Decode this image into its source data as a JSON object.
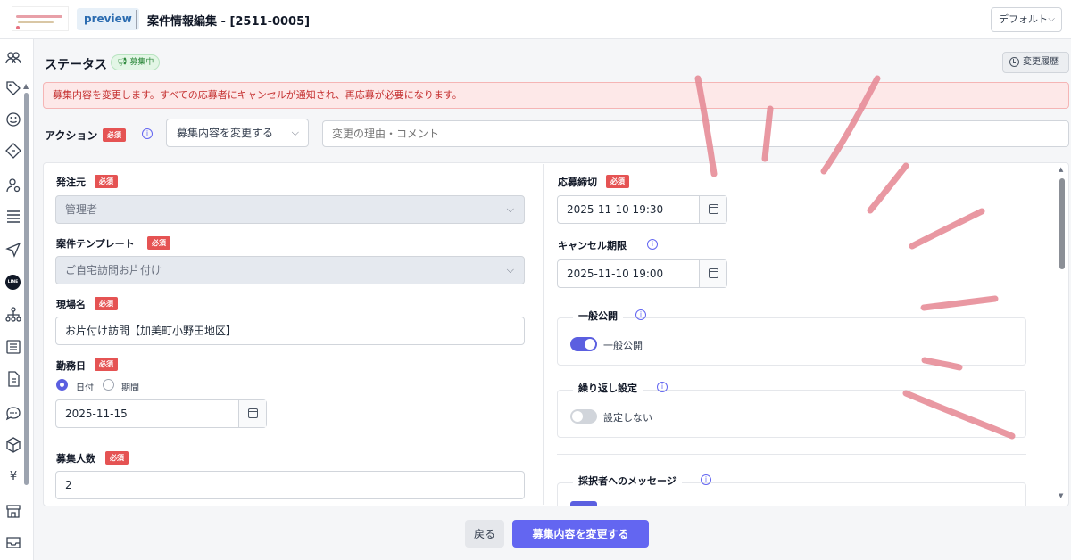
{
  "header": {
    "preview_label": "preview",
    "title": "案件情報編集 - [2511-0005]",
    "view_select": "デフォルト"
  },
  "sidebar": {
    "icons": [
      "people-icon",
      "tag-icon",
      "smile-icon",
      "ticket-icon",
      "user-settings-icon",
      "list-icon",
      "send-icon",
      "line-icon",
      "org-chart-icon",
      "news-icon",
      "document-icon",
      "chat-icon",
      "box-icon",
      "yen-icon",
      "store-icon",
      "tray-icon"
    ],
    "yen_glyph": "¥",
    "line_glyph": "LINE"
  },
  "status": {
    "title": "ステータス",
    "badge": "募集中",
    "history_button": "変更履歴"
  },
  "alert": {
    "message": "募集内容を変更します。すべての応募者にキャンセルが通知され、再応募が必要になります。"
  },
  "action": {
    "label": "アクション",
    "required": "必須",
    "select_value": "募集内容を変更する",
    "reason_placeholder": "変更の理由・コメント"
  },
  "form": {
    "required": "必須",
    "orderer": {
      "label": "発注元",
      "value": "管理者"
    },
    "template": {
      "label": "案件テンプレート",
      "value": "ご自宅訪問お片付け"
    },
    "site_name": {
      "label": "現場名",
      "value": "お片付け訪問【加美町小野田地区】"
    },
    "work_date": {
      "label": "勤務日",
      "options": [
        "日付",
        "期間"
      ],
      "selected": "日付",
      "value": "2025-11-15"
    },
    "headcount": {
      "label": "募集人数",
      "value": "2"
    },
    "deadline": {
      "label": "応募締切",
      "value": "2025-11-10 19:30"
    },
    "cancel_deadline": {
      "label": "キャンセル期限",
      "value": "2025-11-10 19:00"
    },
    "public": {
      "legend": "一般公開",
      "toggle_label": "一般公開",
      "on": true
    },
    "repeat": {
      "legend": "繰り返し設定",
      "toggle_label": "設定しない",
      "on": false
    },
    "message": {
      "legend": "採択者へのメッセージ"
    }
  },
  "footer": {
    "back_button": "戻る",
    "submit_button": "募集内容を変更する"
  },
  "colors": {
    "accent": "#6366f1",
    "required_badge": "#e55353",
    "alert_text": "#c53030",
    "alert_bg": "#fde8e8",
    "status_badge": "#2f8a3e",
    "annotation_strokes": "#e68a96"
  }
}
